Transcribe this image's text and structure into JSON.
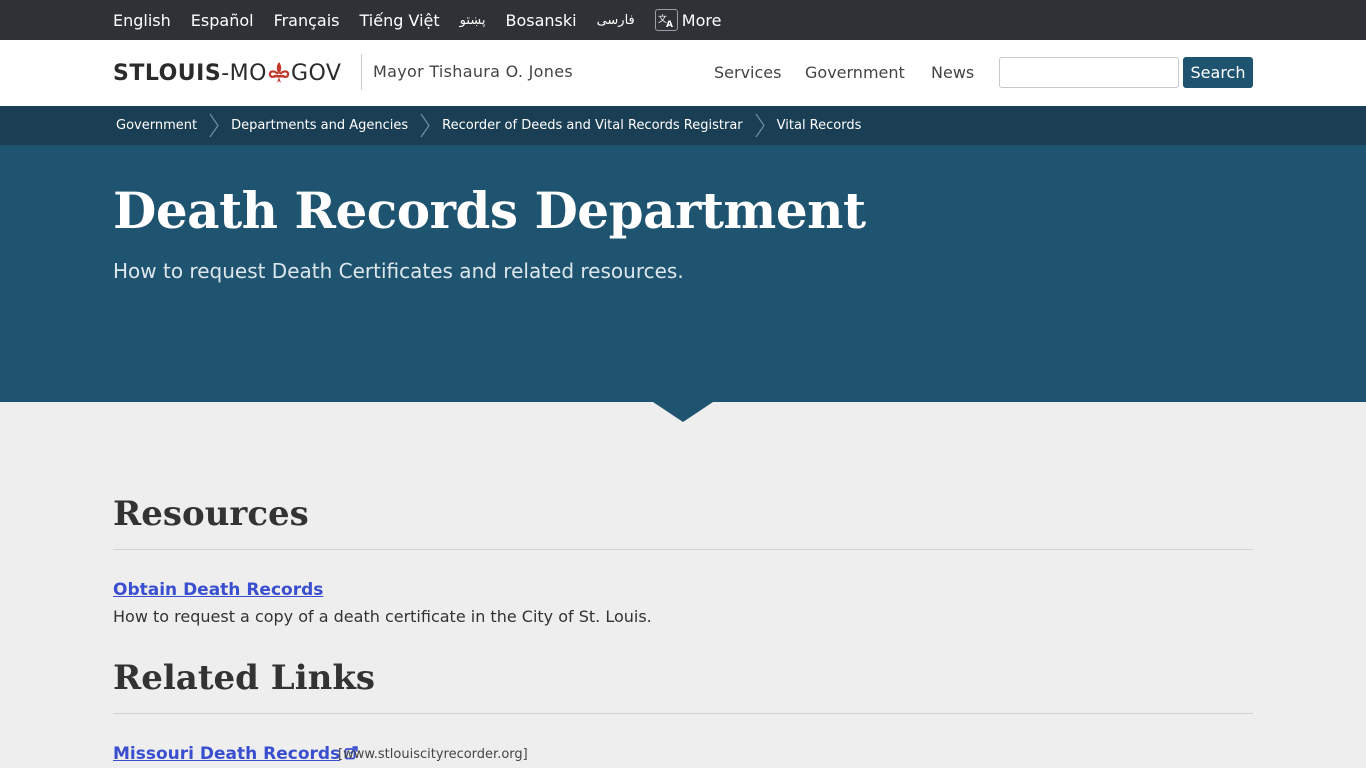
{
  "languages": {
    "items": [
      "English",
      "Español",
      "Français",
      "Tiếng Việt",
      "پښتو",
      "Bosanski",
      "فارسی"
    ],
    "more_label": "More"
  },
  "header": {
    "logo": {
      "part1": "STLOUIS",
      "part2": "-MO",
      "part3": "GOV"
    },
    "mayor": "Mayor Tishaura O. Jones",
    "nav": [
      "Services",
      "Government",
      "News"
    ],
    "search": {
      "button_label": "Search",
      "value": "",
      "placeholder": ""
    }
  },
  "breadcrumb": [
    "Government",
    "Departments and Agencies",
    "Recorder of Deeds and Vital Records Registrar",
    "Vital Records"
  ],
  "hero": {
    "title": "Death Records Department",
    "subtitle": "How to request Death Certificates and related resources."
  },
  "resources": {
    "heading": "Resources",
    "items": [
      {
        "title": "Obtain Death Records",
        "description": "How to request a copy of a death certificate in the City of St. Louis."
      }
    ]
  },
  "related": {
    "heading": "Related Links",
    "items": [
      {
        "title": "Missouri Death Records",
        "domain": "[www.stlouiscityrecorder.org]"
      }
    ]
  },
  "colors": {
    "langbar_bg": "#2e3236",
    "breadcrumb_bg": "#1a3f54",
    "hero_bg": "#1f5470",
    "link": "#3a4fcf",
    "fleur": "#c0392b"
  },
  "icons": [
    "translate-icon",
    "fleur-de-lis-icon",
    "chevron-right-icon",
    "external-link-icon"
  ]
}
